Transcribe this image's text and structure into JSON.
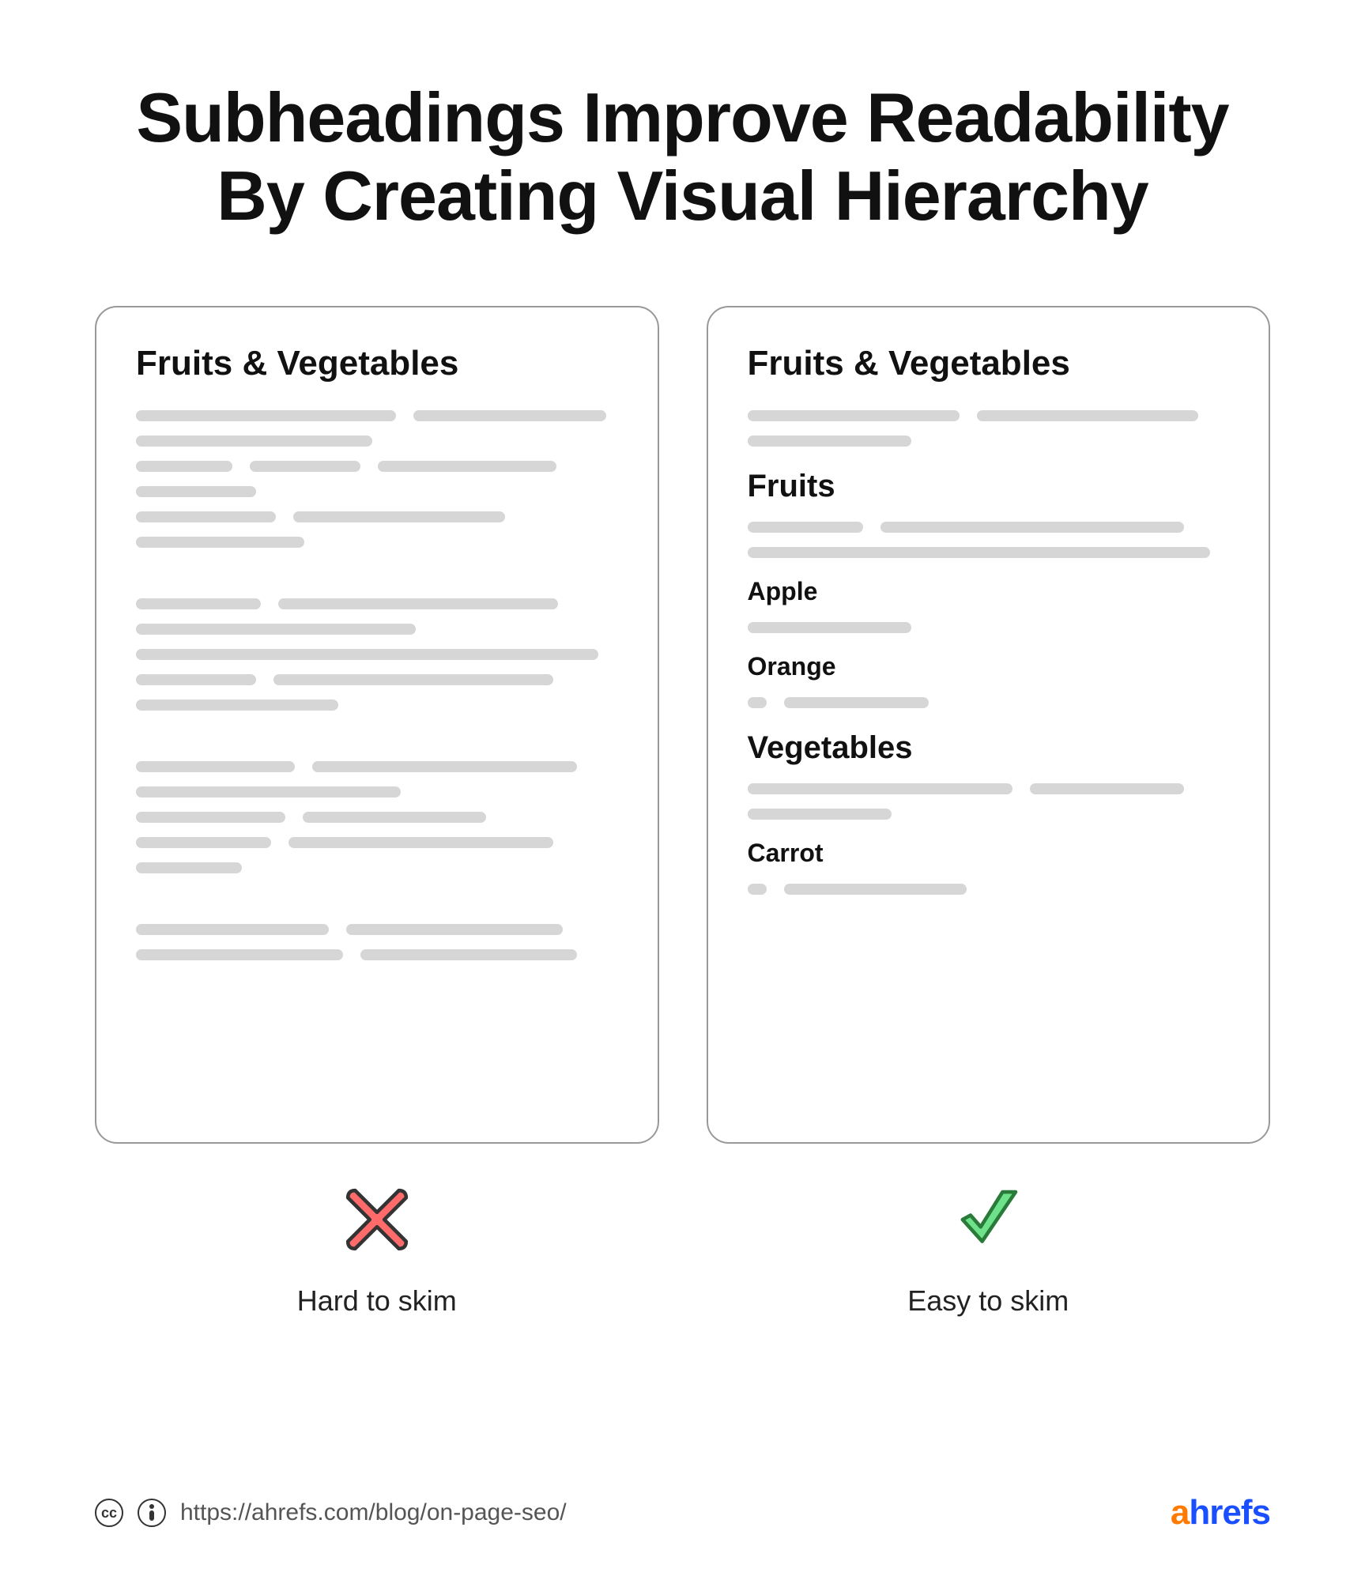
{
  "title": "Subheadings Improve Readability By Creating Visual Hierarchy",
  "left": {
    "card_heading": "Fruits & Vegetables",
    "status": "Hard to skim"
  },
  "right": {
    "card_heading": "Fruits & Vegetables",
    "sub_fruits": "Fruits",
    "item_apple": "Apple",
    "item_orange": "Orange",
    "sub_vegetables": "Vegetables",
    "item_carrot": "Carrot",
    "status": "Easy to skim"
  },
  "footer": {
    "url": "https://ahrefs.com/blog/on-page-seo/",
    "logo_a": "a",
    "logo_rest": "hrefs"
  },
  "colors": {
    "placeholder": "#d6d6d6",
    "cross_fill": "#ff6b6b",
    "cross_stroke": "#333333",
    "check_fill": "#6ee28a",
    "check_stroke": "#2a7a3a"
  }
}
